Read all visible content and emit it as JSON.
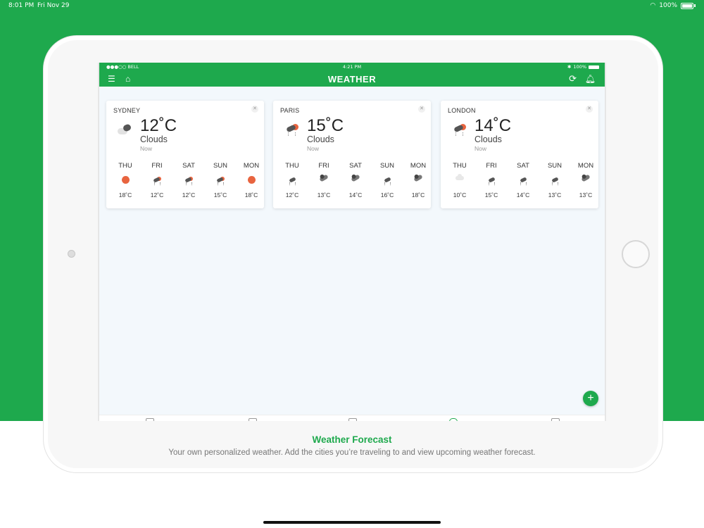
{
  "device_status": {
    "time": "8:01 PM",
    "date": "Fri Nov 29",
    "battery": "100%"
  },
  "app_status": {
    "carrier": "●●●○○ BELL",
    "time": "4:21 PM",
    "battery": "100%"
  },
  "header": {
    "title": "WEATHER"
  },
  "colors": {
    "brand_green": "#1ea94d",
    "sun_orange": "#e8643f"
  },
  "cards": [
    {
      "city": "SYDNEY",
      "temp": "12˚C",
      "condition": "Clouds",
      "when": "Now",
      "icon": "partly-cloudy-icon",
      "forecast": [
        {
          "day": "THU",
          "temp": "18˚C",
          "icon": "sun-icon"
        },
        {
          "day": "FRI",
          "temp": "12˚C",
          "icon": "sun-shower-icon"
        },
        {
          "day": "SAT",
          "temp": "12˚C",
          "icon": "sun-shower-icon"
        },
        {
          "day": "SUN",
          "temp": "15˚C",
          "icon": "sun-shower-icon"
        },
        {
          "day": "MON",
          "temp": "18˚C",
          "icon": "sun-icon"
        }
      ]
    },
    {
      "city": "PARIS",
      "temp": "15˚C",
      "condition": "Clouds",
      "when": "Now",
      "icon": "sun-shower-icon",
      "forecast": [
        {
          "day": "THU",
          "temp": "12˚C",
          "icon": "rain-icon"
        },
        {
          "day": "FRI",
          "temp": "13˚C",
          "icon": "dark-cloud-icon"
        },
        {
          "day": "SAT",
          "temp": "14˚C",
          "icon": "dark-cloud-icon"
        },
        {
          "day": "SUN",
          "temp": "16˚C",
          "icon": "rain-icon"
        },
        {
          "day": "MON",
          "temp": "18˚C",
          "icon": "dark-cloud-icon"
        }
      ]
    },
    {
      "city": "LONDON",
      "temp": "14˚C",
      "condition": "Clouds",
      "when": "Now",
      "icon": "sun-shower-icon",
      "forecast": [
        {
          "day": "THU",
          "temp": "10˚C",
          "icon": "cloud-icon"
        },
        {
          "day": "FRI",
          "temp": "15˚C",
          "icon": "rain-icon"
        },
        {
          "day": "SAT",
          "temp": "14˚C",
          "icon": "rain-icon"
        },
        {
          "day": "SUN",
          "temp": "13˚C",
          "icon": "rain-icon"
        },
        {
          "day": "MON",
          "temp": "13˚C",
          "icon": "dark-cloud-icon"
        }
      ]
    }
  ],
  "fab": {
    "label": "+"
  },
  "caption": {
    "title": "Weather Forecast",
    "text": "Your own personalized weather. Add the cities you’re traveling to and view upcoming weather forecast."
  }
}
